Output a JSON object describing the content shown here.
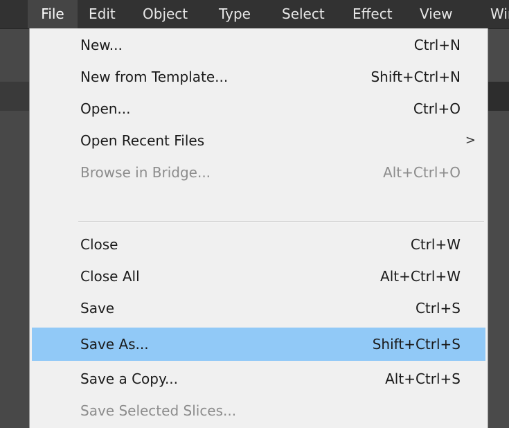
{
  "menubar": {
    "items": [
      {
        "label": "File"
      },
      {
        "label": "Edit"
      },
      {
        "label": "Object"
      },
      {
        "label": "Type"
      },
      {
        "label": "Select"
      },
      {
        "label": "Effect"
      },
      {
        "label": "View"
      },
      {
        "label": "Wir"
      }
    ],
    "active_item": "File"
  },
  "file_menu": {
    "items": [
      {
        "label": "New...",
        "shortcut": "Ctrl+N"
      },
      {
        "label": "New from Template...",
        "shortcut": "Shift+Ctrl+N"
      },
      {
        "label": "Open...",
        "shortcut": "Ctrl+O"
      },
      {
        "label": "Open Recent Files",
        "submenu_arrow": ">"
      },
      {
        "label": "Browse in Bridge...",
        "shortcut": "Alt+Ctrl+O",
        "disabled": true
      },
      {
        "label": "Close",
        "shortcut": "Ctrl+W"
      },
      {
        "label": "Close All",
        "shortcut": "Alt+Ctrl+W"
      },
      {
        "label": "Save",
        "shortcut": "Ctrl+S"
      },
      {
        "label": "Save As...",
        "shortcut": "Shift+Ctrl+S",
        "highlighted": true
      },
      {
        "label": "Save a Copy...",
        "shortcut": "Alt+Ctrl+S"
      },
      {
        "label": "Save Selected Slices...",
        "disabled": true
      }
    ]
  },
  "colors": {
    "menubar_bg": "#323232",
    "menu_bg": "#f0f0f0",
    "highlight": "#91c9f7",
    "disabled_text": "#8c8c8c"
  }
}
